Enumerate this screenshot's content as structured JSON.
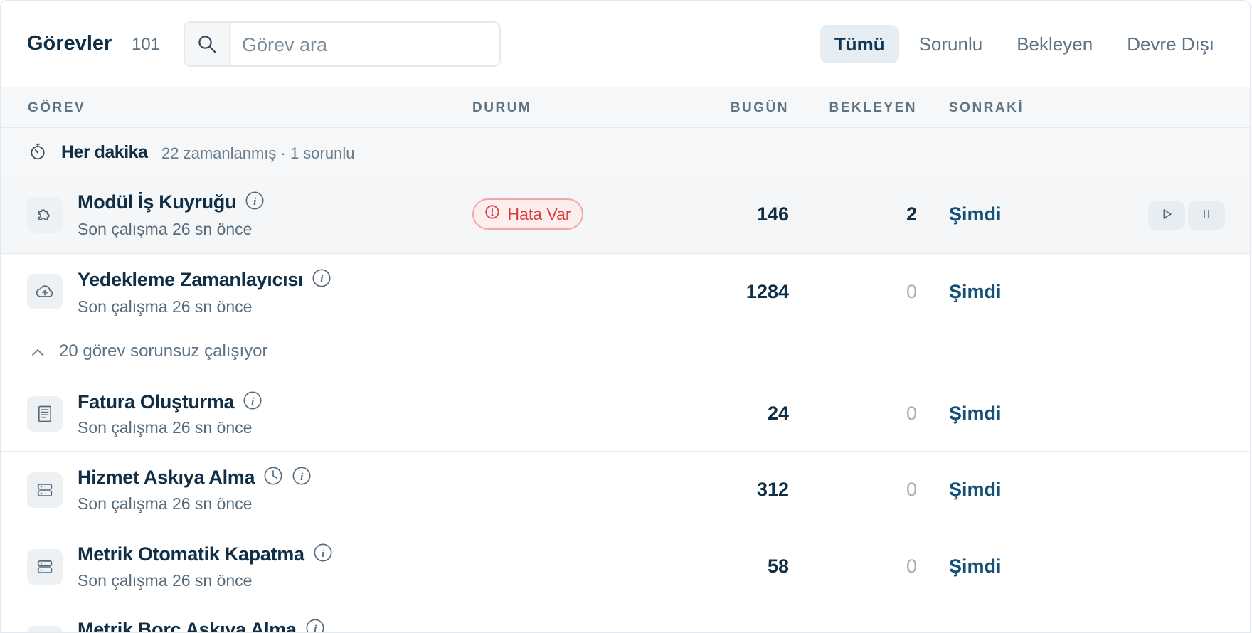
{
  "header": {
    "title": "Görevler",
    "count": "101",
    "search_placeholder": "Görev ara",
    "filters": [
      {
        "label": "Tümü",
        "active": true
      },
      {
        "label": "Sorunlu",
        "active": false
      },
      {
        "label": "Bekleyen",
        "active": false
      },
      {
        "label": "Devre Dışı",
        "active": false
      }
    ]
  },
  "columns": {
    "task": "GÖREV",
    "status": "DURUM",
    "today": "BUGÜN",
    "pending": "BEKLEYEN",
    "next": "SONRAKİ"
  },
  "group": {
    "icon": "stopwatch-icon",
    "name": "Her dakika",
    "summary": "22 zamanlanmış · 1 sorunlu"
  },
  "rows": [
    {
      "name": "Modül İş Kuyruğu",
      "sub": "Son çalışma 26 sn önce",
      "status": "Hata Var",
      "today": "146",
      "pending": "2",
      "next": "Şimdi",
      "icon": "puzzle-icon"
    },
    {
      "name": "Yedekleme Zamanlayıcısı",
      "sub": "Son çalışma 26 sn önce",
      "status": "",
      "today": "1284",
      "pending": "0",
      "next": "Şimdi",
      "icon": "cloud-upload-icon"
    },
    {
      "name": "Fatura Oluşturma",
      "sub": "Son çalışma 26 sn önce",
      "status": "",
      "today": "24",
      "pending": "0",
      "next": "Şimdi",
      "icon": "receipt-icon"
    },
    {
      "name": "Hizmet Askıya Alma",
      "sub": "Son çalışma 26 sn önce",
      "status": "",
      "today": "312",
      "pending": "0",
      "next": "Şimdi",
      "icon": "server-icon"
    },
    {
      "name": "Metrik Otomatik Kapatma",
      "sub": "Son çalışma 26 sn önce",
      "status": "",
      "today": "58",
      "pending": "0",
      "next": "Şimdi",
      "icon": "server-icon"
    },
    {
      "name": "Metrik Borç Askıya Alma",
      "sub": "",
      "status": "",
      "today": "",
      "pending": "",
      "next": "",
      "icon": "server-icon"
    }
  ],
  "expander": {
    "label": "20 görev sorunsuz çalışıyor"
  },
  "colors": {
    "accent": "#155077",
    "error": "#d73d43",
    "error_bg": "#fdeeee",
    "text": "#102f47",
    "muted": "#566b7c"
  }
}
